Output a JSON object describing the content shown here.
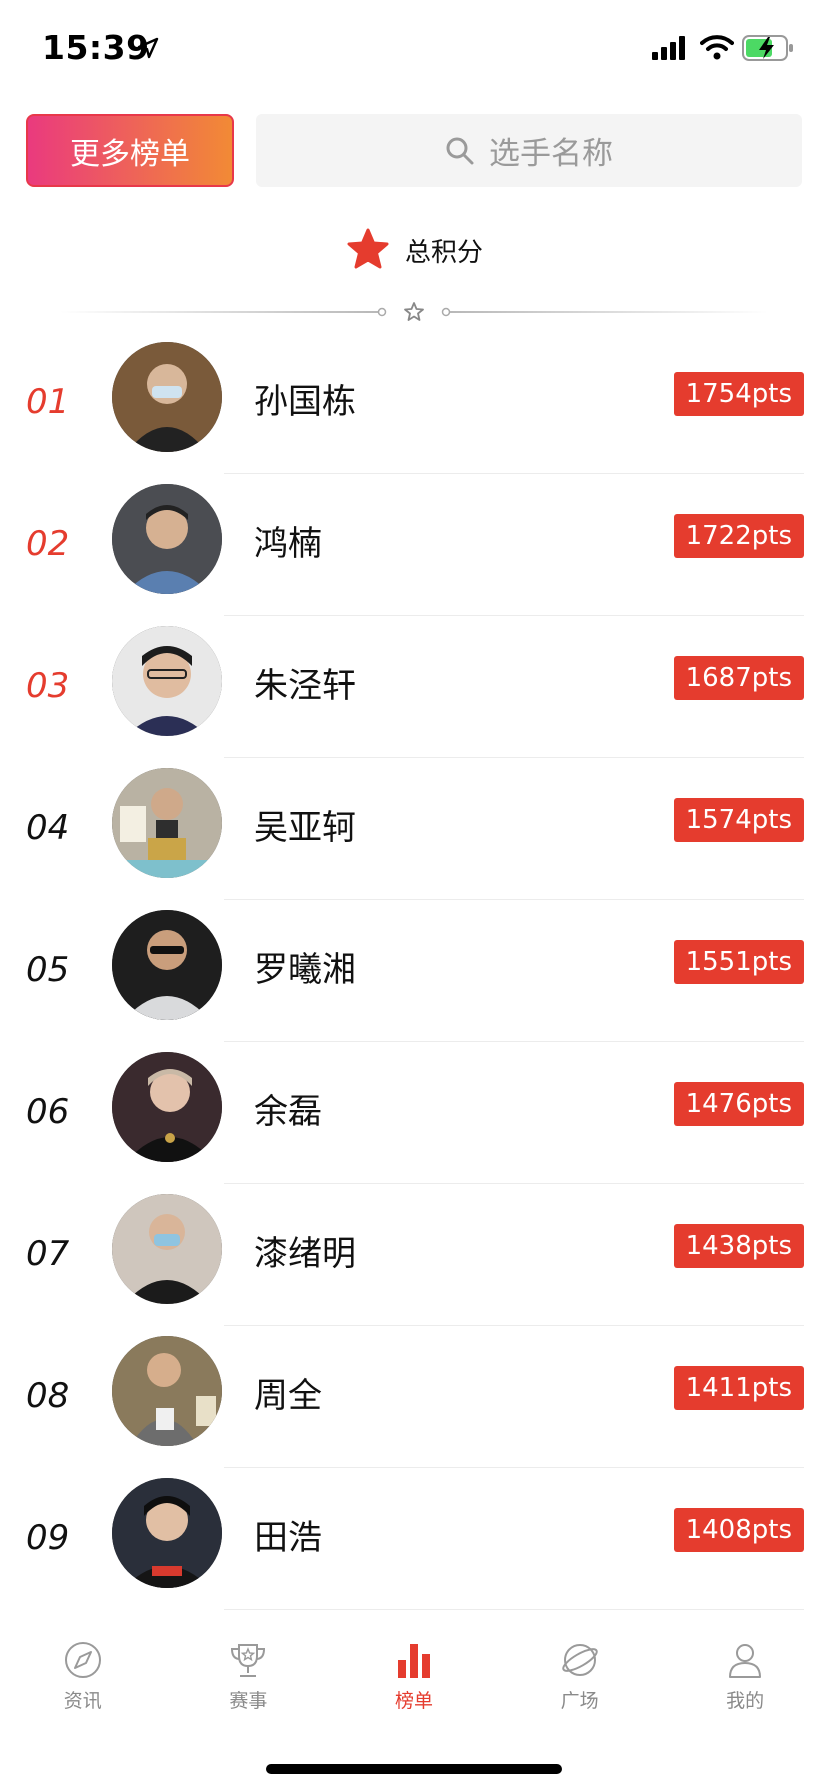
{
  "status_bar": {
    "time": "15:39",
    "icons": [
      "location-arrow-icon",
      "cellular-signal-icon",
      "wifi-icon",
      "battery-charging-icon"
    ]
  },
  "top": {
    "more_label": "更多榜单",
    "search_placeholder": "选手名称"
  },
  "section": {
    "title": "总积分",
    "icon": "star-icon"
  },
  "colors": {
    "accent": "#e53c2e",
    "button_gradient_start": "#ea3a7e",
    "button_gradient_end": "#f28a35",
    "search_bg": "#f4f4f4",
    "muted_text": "#8a8a8a"
  },
  "players": [
    {
      "rank": "01",
      "name": "孙国栋",
      "pts": "1754pts"
    },
    {
      "rank": "02",
      "name": "鸿楠",
      "pts": "1722pts"
    },
    {
      "rank": "03",
      "name": "朱泾轩",
      "pts": "1687pts"
    },
    {
      "rank": "04",
      "name": "吴亚轲",
      "pts": "1574pts"
    },
    {
      "rank": "05",
      "name": "罗曦湘",
      "pts": "1551pts"
    },
    {
      "rank": "06",
      "name": "余磊",
      "pts": "1476pts"
    },
    {
      "rank": "07",
      "name": "漆绪明",
      "pts": "1438pts"
    },
    {
      "rank": "08",
      "name": "周全",
      "pts": "1411pts"
    },
    {
      "rank": "09",
      "name": "田浩",
      "pts": "1408pts"
    }
  ],
  "tabs": [
    {
      "label": "资讯",
      "icon": "compass-icon",
      "active": false
    },
    {
      "label": "赛事",
      "icon": "trophy-icon",
      "active": false
    },
    {
      "label": "榜单",
      "icon": "bar-chart-icon",
      "active": true
    },
    {
      "label": "广场",
      "icon": "planet-icon",
      "active": false
    },
    {
      "label": "我的",
      "icon": "user-icon",
      "active": false
    }
  ]
}
